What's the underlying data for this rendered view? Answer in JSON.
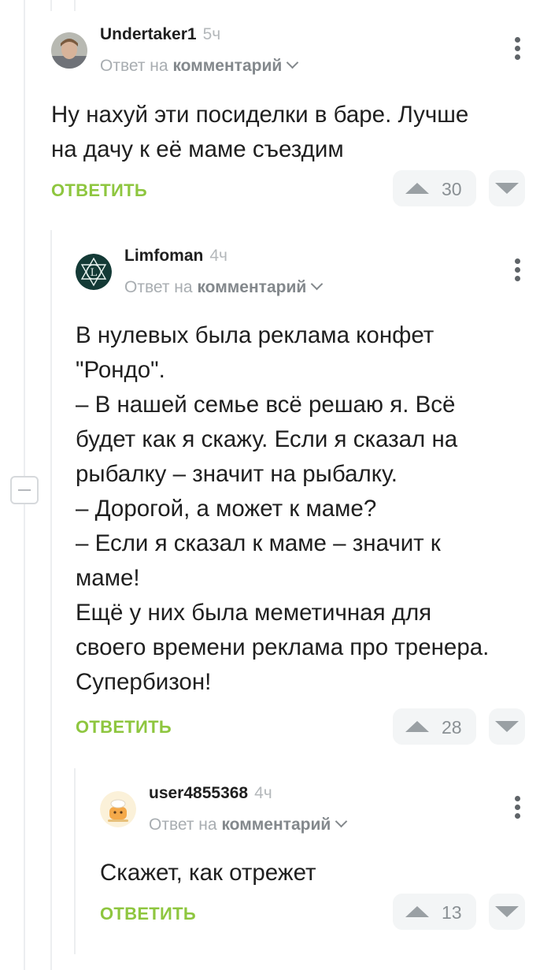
{
  "comments": [
    {
      "author": "Undertaker1",
      "time": "5ч",
      "reply_prefix": "Ответ на",
      "reply_target": "комментарий",
      "text": "Ну нахуй эти посиделки в баре. Лучше\nна дачу к её маме съездим",
      "reply_label": "ОТВЕТИТЬ",
      "rating": "30"
    },
    {
      "author": "Limfoman",
      "time": "4ч",
      "reply_prefix": "Ответ на",
      "reply_target": "комментарий",
      "text": "В нулевых была реклама конфет\n\"Рондо\".\n– В нашей семье всё решаю я. Всё\nбудет как я скажу. Если я сказал на\nрыбалку – значит на рыбалку.\n– Дорогой, а может к маме?\n– Если я сказал к маме – значит к\nмаме!\nЕщё у них была меметичная для\nсвоего времени реклама про тренера.\nСупербизон!",
      "reply_label": "ОТВЕТИТЬ",
      "rating": "28"
    },
    {
      "author": "user4855368",
      "time": "4ч",
      "reply_prefix": "Ответ на",
      "reply_target": "комментарий",
      "text": "Скажет, как отрежет",
      "reply_label": "ОТВЕТИТЬ",
      "rating": "13"
    }
  ],
  "colors": {
    "accent": "#8ec63f",
    "meta_text": "#a8adb1",
    "thread_line": "#eceef0",
    "vote_bg": "#f3f5f6"
  }
}
